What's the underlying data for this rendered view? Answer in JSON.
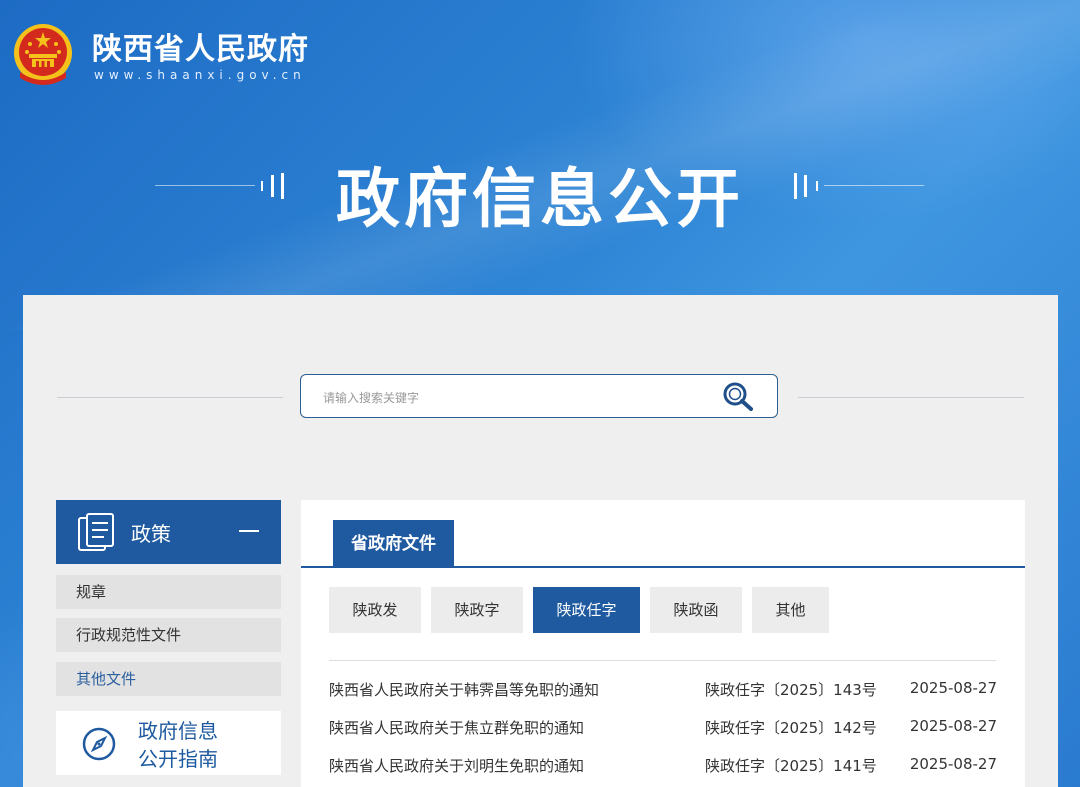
{
  "header": {
    "site_name": "陕西省人民政府",
    "site_url": "www.shaanxi.gov.cn",
    "banner_title": "政府信息公开"
  },
  "search": {
    "placeholder": "请输入搜索关键字",
    "icon": "search-icon"
  },
  "sidebar": {
    "section_title": "政策",
    "section_icon": "document-icon",
    "collapse_icon": "minus-icon",
    "items": [
      {
        "label": "规章"
      },
      {
        "label": "行政规范性文件"
      },
      {
        "label": "其他文件",
        "active": true
      }
    ],
    "guide": {
      "line1": "政府信息",
      "line2": "公开指南",
      "icon": "compass-icon"
    }
  },
  "panel": {
    "tab_label": "省政府文件",
    "filters": [
      {
        "label": "陕政发"
      },
      {
        "label": "陕政字"
      },
      {
        "label": "陕政任字",
        "active": true
      },
      {
        "label": "陕政函"
      },
      {
        "label": "其他"
      }
    ],
    "documents": [
      {
        "title": "陕西省人民政府关于韩霁昌等免职的通知",
        "doc_no": "陕政任字〔2025〕143号",
        "date": "2025-08-27"
      },
      {
        "title": "陕西省人民政府关于焦立群免职的通知",
        "doc_no": "陕政任字〔2025〕142号",
        "date": "2025-08-27"
      },
      {
        "title": "陕西省人民政府关于刘明生免职的通知",
        "doc_no": "陕政任字〔2025〕141号",
        "date": "2025-08-27"
      }
    ]
  },
  "colors": {
    "primary": "#1f5aa0",
    "banner": "#2f86d6",
    "emblem_red": "#d42a1e",
    "emblem_gold": "#f4c21a"
  }
}
